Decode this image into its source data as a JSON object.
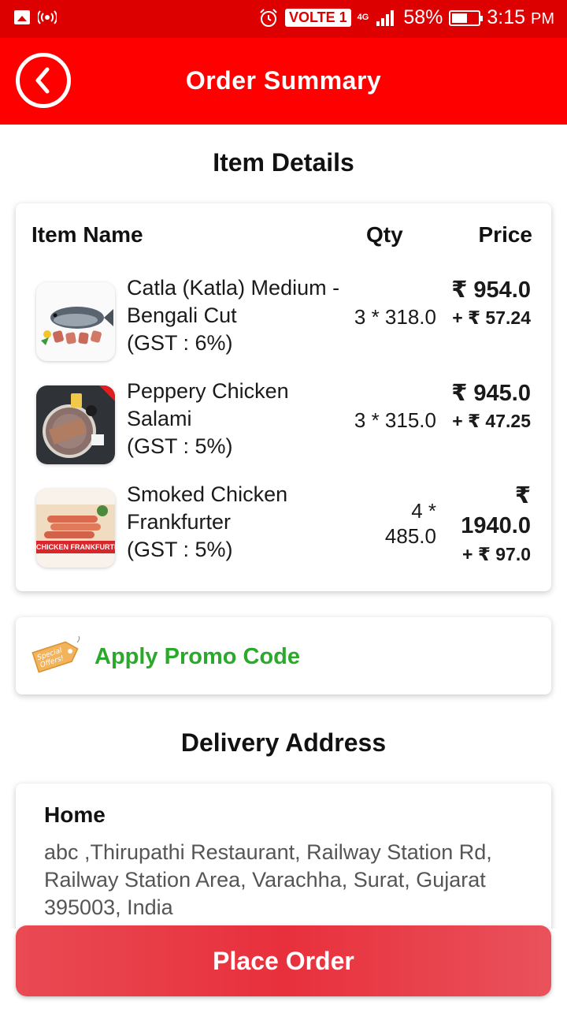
{
  "status_bar": {
    "volte": "VOLTE 1",
    "network": "4G",
    "battery": "58%",
    "battery_level": 0.58,
    "time": "3:15",
    "ampm": "PM"
  },
  "app_bar": {
    "title": "Order Summary"
  },
  "item_details": {
    "title": "Item Details",
    "headers": {
      "name": "Item Name",
      "qty": "Qty",
      "price": "Price"
    },
    "items": [
      {
        "name": "Catla (Katla) Medium - Bengali Cut",
        "gst": "(GST : 6%)",
        "qty": "3 * 318.0",
        "price": "₹ 954.0",
        "tax": "+ ₹ 57.24",
        "icon": "fish-icon"
      },
      {
        "name": "Peppery Chicken Salami",
        "gst": "(GST : 5%)",
        "qty": "3 * 315.0",
        "price": "₹ 945.0",
        "tax": "+ ₹ 47.25",
        "icon": "salami-icon"
      },
      {
        "name": "Smoked Chicken Frankfurter",
        "gst": "(GST : 5%)",
        "qty": "4 * 485.0",
        "price": "₹ 1940.0",
        "tax": "+ ₹ 97.0",
        "icon": "sausage-icon",
        "image_label": "CHICKEN FRANKFURTER"
      }
    ]
  },
  "promo": {
    "label": "Apply Promo Code",
    "tag_text": "Special Offers!",
    "color": "#2aa92a"
  },
  "delivery": {
    "title": "Delivery Address",
    "label": "Home",
    "address": "abc ,Thirupathi Restaurant, Railway Station Rd, Railway Station Area, Varachha, Surat, Gujarat 395003, India"
  },
  "place_order": {
    "label": "Place Order"
  },
  "colors": {
    "status_bar": "#dd0000",
    "app_bar": "#ff0000",
    "button": "#e8303c"
  }
}
